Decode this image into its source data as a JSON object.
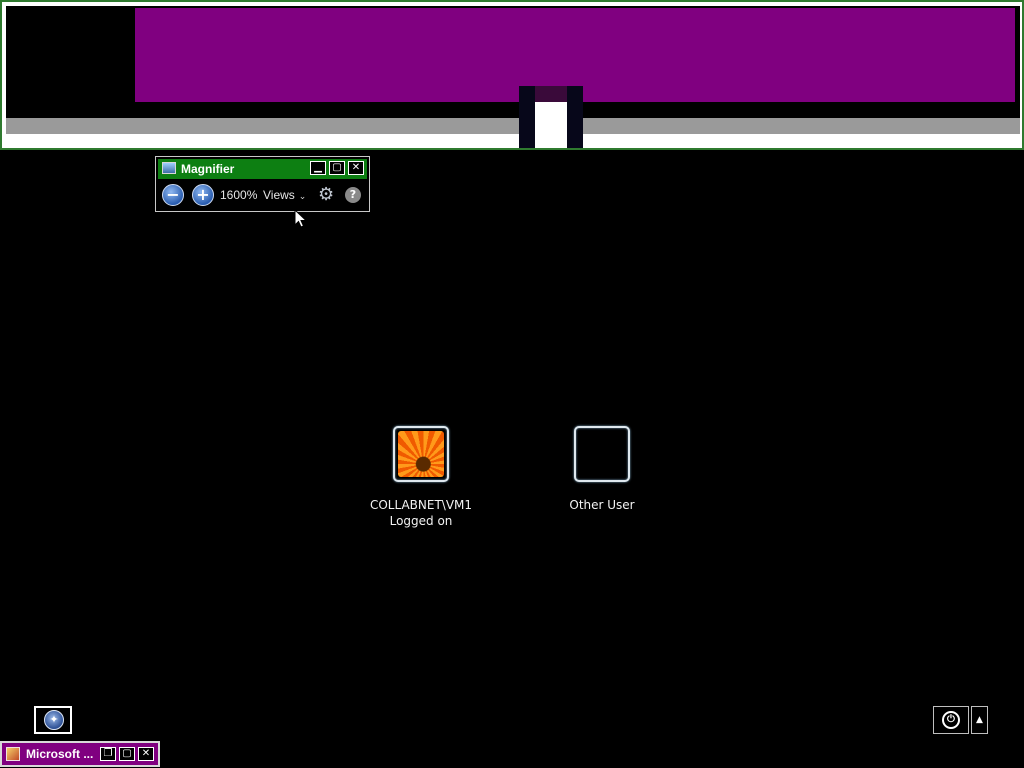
{
  "magnifier": {
    "title": "Magnifier",
    "zoom_out_symbol": "−",
    "zoom_in_symbol": "+",
    "zoom_level": "1600%",
    "views_label": "Views",
    "views_chevron": "⌄",
    "options_icon": "gear-icon",
    "help_symbol": "?",
    "caption": {
      "minimize": "▁",
      "maximize": "▢",
      "close": "✕"
    }
  },
  "users": [
    {
      "name": "COLLABNET\\VM1",
      "status": "Logged on",
      "picture": "orange-flower"
    },
    {
      "name": "Other User",
      "status": "",
      "picture": "blank"
    }
  ],
  "ease_of_access": {
    "symbol": "✦"
  },
  "power": {
    "symbol": "⏻",
    "arrow": "▲"
  },
  "minimized_window": {
    "label": "Microsoft ...",
    "caption": {
      "restore": "❐",
      "maximize": "▢",
      "close": "✕"
    }
  },
  "colors": {
    "magnifier_title_bar": "#0d7f12",
    "lens_highlight": "#800080",
    "minimized_bar": "#800080",
    "background": "#000000"
  }
}
